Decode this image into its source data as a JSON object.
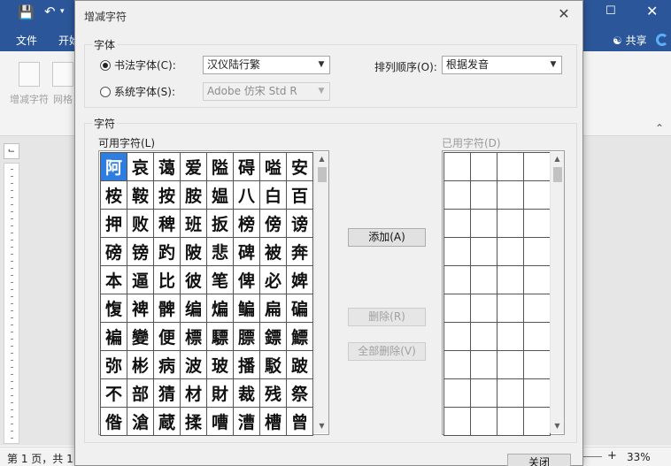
{
  "word": {
    "tabs": [
      "文件",
      "开始"
    ],
    "share_label": "共享",
    "ribbon_buttons": [
      "增减字符",
      "网格"
    ],
    "status_text": "第 1 页，共 1",
    "zoom": "33%"
  },
  "dialog": {
    "title": "增减字符",
    "font_group": {
      "legend": "字体",
      "calligraphy_label": "书法字体(C):",
      "calligraphy_value": "汉仪陆行繁",
      "system_label": "系统字体(S):",
      "system_value": "Adobe 仿宋 Std R",
      "sort_label": "排列顺序(O):",
      "sort_value": "根据发音"
    },
    "chars_group": {
      "legend": "字符",
      "available_label": "可用字符(L)",
      "used_label": "已用字符(D)",
      "available_chars": [
        [
          "阿",
          "哀",
          "蔼",
          "爱",
          "隘",
          "碍",
          "嗌",
          "安"
        ],
        [
          "桉",
          "鞍",
          "按",
          "胺",
          "媪",
          "八",
          "白",
          "百"
        ],
        [
          "押",
          "败",
          "稗",
          "班",
          "扳",
          "榜",
          "傍",
          "谤"
        ],
        [
          "磅",
          "镑",
          "趵",
          "陂",
          "悲",
          "碑",
          "被",
          "奔"
        ],
        [
          "本",
          "逼",
          "比",
          "彼",
          "笔",
          "俾",
          "必",
          "婢"
        ],
        [
          "愎",
          "裨",
          "髀",
          "编",
          "煸",
          "鳊",
          "扁",
          "碥"
        ],
        [
          "褊",
          "變",
          "便",
          "標",
          "驃",
          "膘",
          "鏢",
          "鰾"
        ],
        [
          "弥",
          "彬",
          "病",
          "波",
          "玻",
          "播",
          "駁",
          "跛"
        ],
        [
          "不",
          "部",
          "猜",
          "材",
          "財",
          "裁",
          "残",
          "祭"
        ],
        [
          "偺",
          "滄",
          "蔵",
          "揉",
          "嘈",
          "漕",
          "槽",
          "曾"
        ]
      ],
      "add_button": "添加(A)",
      "delete_button": "删除(R)",
      "delete_all_button": "全部删除(V)"
    },
    "close_button": "关闭"
  }
}
